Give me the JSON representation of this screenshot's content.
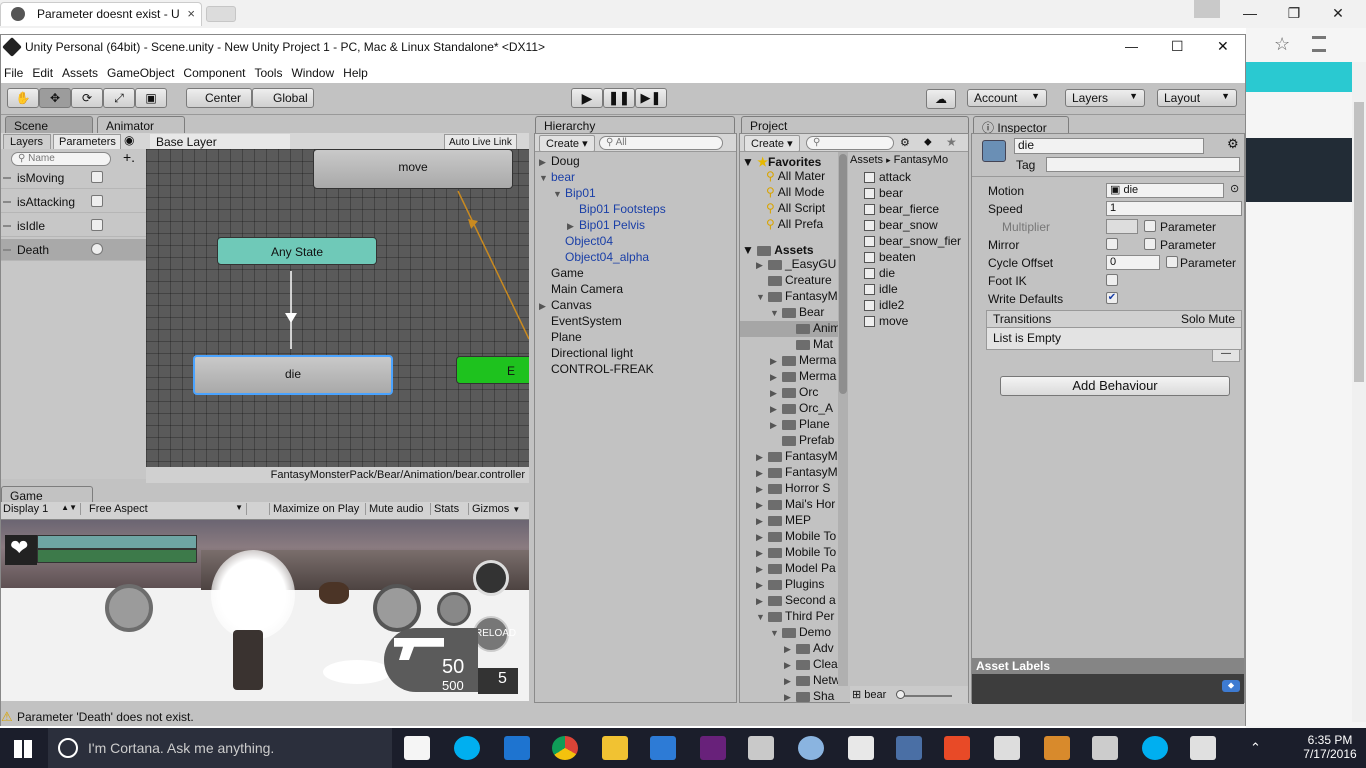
{
  "browser": {
    "tab_title": "Parameter doesnt exist - U",
    "close_glyph": "×",
    "win_min": "—",
    "win_restore": "❐",
    "win_close": "✕",
    "star_glyph": "☆"
  },
  "unity": {
    "title": "Unity Personal (64bit) - Scene.unity - New Unity Project 1 - PC, Mac & Linux Standalone* <DX11>",
    "win_min": "—",
    "win_max": "☐",
    "win_close": "✕",
    "menu": [
      "File",
      "Edit",
      "Assets",
      "GameObject",
      "Component",
      "Tools",
      "Window",
      "Help"
    ],
    "toolbar": {
      "pivot": "Center",
      "space": "Global",
      "account": "Account",
      "layers": "Layers",
      "layout": "Layout"
    },
    "tabs": {
      "scene": "Scene",
      "animator": "Animator",
      "hierarchy": "Hierarchy",
      "project": "Project",
      "inspector": "Inspector",
      "game": "Game"
    },
    "animator": {
      "layers_tab": "Layers",
      "parameters_tab": "Parameters",
      "search_placeholder": "Name",
      "base_layer": "Base Layer",
      "auto_live_link": "Auto Live Link",
      "parameters": [
        {
          "name": "isMoving",
          "type": "bool"
        },
        {
          "name": "isAttacking",
          "type": "bool"
        },
        {
          "name": "isIdle",
          "type": "bool"
        },
        {
          "name": "Death",
          "type": "trigger"
        }
      ],
      "states": {
        "move": "move",
        "any_state": "Any State",
        "die": "die",
        "entry": "E"
      },
      "controller_path": "FantasyMonsterPack/Bear/Animation/bear.controller"
    },
    "game": {
      "display": "Display 1",
      "aspect": "Free Aspect",
      "maximize": "Maximize on Play",
      "mute": "Mute audio",
      "stats": "Stats",
      "gizmos": "Gizmos",
      "ammo": "50",
      "ammo_total": "500",
      "grenades": "5",
      "reload": "RELOAD"
    },
    "hierarchy": {
      "create": "Create",
      "search_placeholder": "All",
      "items": [
        {
          "label": "Doug",
          "indent": 0,
          "arrow": "▶",
          "blue": false
        },
        {
          "label": "bear",
          "indent": 0,
          "arrow": "▼",
          "blue": true
        },
        {
          "label": "Bip01",
          "indent": 1,
          "arrow": "▼",
          "blue": true
        },
        {
          "label": "Bip01 Footsteps",
          "indent": 2,
          "arrow": "",
          "blue": true
        },
        {
          "label": "Bip01 Pelvis",
          "indent": 2,
          "arrow": "▶",
          "blue": true
        },
        {
          "label": "Object04",
          "indent": 1,
          "arrow": "",
          "blue": true
        },
        {
          "label": "Object04_alpha",
          "indent": 1,
          "arrow": "",
          "blue": true
        },
        {
          "label": "Game",
          "indent": 0,
          "arrow": "",
          "blue": false
        },
        {
          "label": "Main Camera",
          "indent": 0,
          "arrow": "",
          "blue": false
        },
        {
          "label": "Canvas",
          "indent": 0,
          "arrow": "▶",
          "blue": false
        },
        {
          "label": "EventSystem",
          "indent": 0,
          "arrow": "",
          "blue": false
        },
        {
          "label": "Plane",
          "indent": 0,
          "arrow": "",
          "blue": false
        },
        {
          "label": "Directional light",
          "indent": 0,
          "arrow": "",
          "blue": false
        },
        {
          "label": "CONTROL-FREAK",
          "indent": 0,
          "arrow": "",
          "blue": false
        }
      ]
    },
    "project": {
      "create": "Create",
      "favorites": "Favorites",
      "favorites_items": [
        "All Mater",
        "All Mode",
        "All Script",
        "All Prefa"
      ],
      "assets": "Assets",
      "tree": [
        {
          "label": "_EasyGU",
          "indent": 1,
          "arrow": "▶"
        },
        {
          "label": "Creature",
          "indent": 1,
          "arrow": ""
        },
        {
          "label": "FantasyM",
          "indent": 1,
          "arrow": "▼"
        },
        {
          "label": "Bear",
          "indent": 2,
          "arrow": "▼"
        },
        {
          "label": "Anim",
          "indent": 3,
          "arrow": "",
          "selected": true
        },
        {
          "label": "Mat",
          "indent": 3,
          "arrow": ""
        },
        {
          "label": "Merma",
          "indent": 2,
          "arrow": "▶"
        },
        {
          "label": "Merma",
          "indent": 2,
          "arrow": "▶"
        },
        {
          "label": "Orc",
          "indent": 2,
          "arrow": "▶"
        },
        {
          "label": "Orc_A",
          "indent": 2,
          "arrow": "▶"
        },
        {
          "label": "Plane",
          "indent": 2,
          "arrow": "▶"
        },
        {
          "label": "Prefab",
          "indent": 2,
          "arrow": ""
        },
        {
          "label": "FantasyM",
          "indent": 1,
          "arrow": "▶"
        },
        {
          "label": "FantasyM",
          "indent": 1,
          "arrow": "▶"
        },
        {
          "label": "Horror S",
          "indent": 1,
          "arrow": "▶"
        },
        {
          "label": "Mai's Hor",
          "indent": 1,
          "arrow": "▶"
        },
        {
          "label": "MEP",
          "indent": 1,
          "arrow": "▶"
        },
        {
          "label": "Mobile To",
          "indent": 1,
          "arrow": "▶"
        },
        {
          "label": "Mobile To",
          "indent": 1,
          "arrow": "▶"
        },
        {
          "label": "Model Pa",
          "indent": 1,
          "arrow": "▶"
        },
        {
          "label": "Plugins",
          "indent": 1,
          "arrow": "▶"
        },
        {
          "label": "Second a",
          "indent": 1,
          "arrow": "▶"
        },
        {
          "label": "Third Per",
          "indent": 1,
          "arrow": "▼"
        },
        {
          "label": "Demo",
          "indent": 2,
          "arrow": "▼"
        },
        {
          "label": "Adv",
          "indent": 3,
          "arrow": "▶"
        },
        {
          "label": "Clea",
          "indent": 3,
          "arrow": "▶"
        },
        {
          "label": "Netw",
          "indent": 3,
          "arrow": "▶"
        },
        {
          "label": "Sha",
          "indent": 3,
          "arrow": "▶"
        }
      ],
      "breadcrumb_root": "Assets",
      "breadcrumb_sep": "▸",
      "breadcrumb_child": "FantasyMo",
      "files": [
        "attack",
        "bear",
        "bear_fierce",
        "bear_snow",
        "bear_snow_fier",
        "beaten",
        "die",
        "idle",
        "idle2",
        "move"
      ],
      "footer_label": "bear"
    },
    "inspector": {
      "name": "die",
      "tag": "Tag",
      "rows": {
        "motion": "Motion",
        "motion_value": "die",
        "speed": "Speed",
        "speed_value": "1",
        "multiplier": "Multiplier",
        "parameter": "Parameter",
        "mirror": "Mirror",
        "cycle_offset": "Cycle Offset",
        "cycle_offset_value": "0",
        "foot_ik": "Foot IK",
        "write_defaults": "Write Defaults"
      },
      "transitions": "Transitions",
      "solo_mute": "Solo Mute",
      "list_empty": "List is Empty",
      "add_behaviour": "Add Behaviour",
      "asset_labels": "Asset Labels"
    },
    "status": "Parameter 'Death' does not exist."
  },
  "taskbar": {
    "cortana": "I'm Cortana. Ask me anything.",
    "time": "6:35 PM",
    "date": "7/17/2016"
  },
  "colors": {
    "any_state": "#6fc9b8",
    "entry": "#1ec21e",
    "selected_node_border": "#4aa3ff",
    "cyan_accent": "#2ac9d1"
  }
}
